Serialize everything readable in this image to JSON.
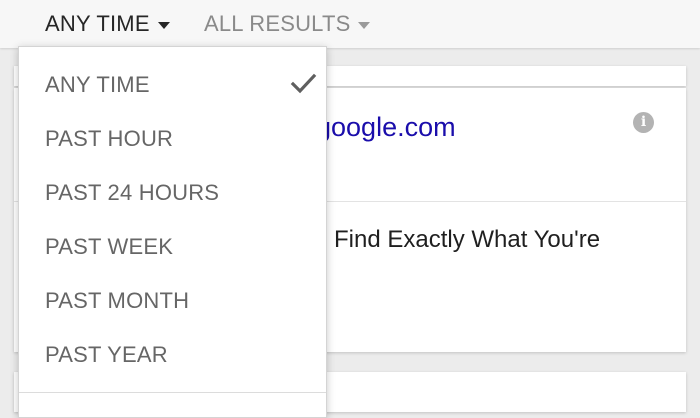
{
  "filters": {
    "time_label": "ANY TIME",
    "results_label": "ALL RESULTS"
  },
  "result": {
    "url": "google.com",
    "title": "Find Exactly What You're",
    "info_icon": "info-icon"
  },
  "menu": {
    "selected": "ANY TIME",
    "items": [
      {
        "label": "ANY TIME",
        "checked": true
      },
      {
        "label": "PAST HOUR"
      },
      {
        "label": "PAST 24 HOURS"
      },
      {
        "label": "PAST WEEK"
      },
      {
        "label": "PAST MONTH"
      },
      {
        "label": "PAST YEAR"
      }
    ],
    "check_icon": "checkmark-icon"
  },
  "colors": {
    "link": "#1a0dab",
    "active_filter": "#262626",
    "inactive_filter": "#8a8a8a",
    "menu_text": "#666666"
  }
}
